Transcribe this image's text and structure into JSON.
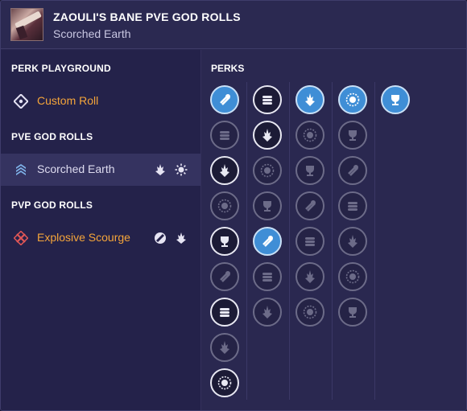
{
  "header": {
    "title": "ZAOULI'S BANE PVE GOD ROLLS",
    "subtitle": "Scorched Earth",
    "thumbnail_icon": "rocket-launcher-weapon-icon"
  },
  "sidebar": {
    "playground_header": "PERK PLAYGROUND",
    "custom_roll": {
      "label": "Custom Roll",
      "icon": "target-dot-icon"
    },
    "pve_header": "PVE GOD ROLLS",
    "pve_items": [
      {
        "label": "Scorched Earth",
        "icon": "chevron-rank-icon",
        "selected": true,
        "perk_icons": [
          "spire-perk-icon",
          "sunburst-perk-icon"
        ]
      }
    ],
    "pvp_header": "PVP GOD ROLLS",
    "pvp_items": [
      {
        "label": "Explosive Scourge",
        "icon": "crossed-x-icon",
        "selected": false,
        "perk_icons": [
          "slug-perk-icon",
          "spire-perk-icon"
        ]
      }
    ]
  },
  "perks": {
    "title": "PERKS",
    "accent": "#3f8ed6",
    "columns": [
      {
        "name": "barrel",
        "perks": [
          {
            "icon": "tube-launcher-icon",
            "state": "selected"
          },
          {
            "icon": "hatched-barrel-icon",
            "state": "dim"
          },
          {
            "icon": "smooth-bore-icon",
            "state": "available"
          },
          {
            "icon": "sight-bore-icon",
            "state": "dim"
          },
          {
            "icon": "crossed-bore-icon",
            "state": "available"
          },
          {
            "icon": "long-barrel-icon",
            "state": "dim"
          },
          {
            "icon": "ringed-barrel-icon",
            "state": "available"
          },
          {
            "icon": "coiled-barrel-icon",
            "state": "dim"
          },
          {
            "icon": "spiral-barrel-icon",
            "state": "available"
          }
        ]
      },
      {
        "name": "magazine",
        "perks": [
          {
            "icon": "stacked-rounds-icon",
            "state": "available"
          },
          {
            "icon": "card-magazine-icon",
            "state": "available"
          },
          {
            "icon": "tracker-round-icon",
            "state": "dim"
          },
          {
            "icon": "slim-mag-icon",
            "state": "dim"
          },
          {
            "icon": "folded-mag-icon",
            "state": "selected"
          },
          {
            "icon": "layered-mag-icon",
            "state": "dim"
          },
          {
            "icon": "crosshair-round-icon",
            "state": "dim"
          }
        ]
      },
      {
        "name": "trait-1",
        "perks": [
          {
            "icon": "spire-perk-icon",
            "state": "selected"
          },
          {
            "icon": "star-burst-icon",
            "state": "dim"
          },
          {
            "icon": "stacked-plates-icon",
            "state": "dim"
          },
          {
            "icon": "diamond-arrow-icon",
            "state": "dim"
          },
          {
            "icon": "figure-shield-icon",
            "state": "dim"
          },
          {
            "icon": "cross-ball-icon",
            "state": "dim"
          },
          {
            "icon": "ornate-ring-icon",
            "state": "dim"
          }
        ]
      },
      {
        "name": "trait-2",
        "perks": [
          {
            "icon": "sunburst-perk-icon",
            "state": "selected"
          },
          {
            "icon": "compass-rose-icon",
            "state": "dim"
          },
          {
            "icon": "flame-wreath-icon",
            "state": "dim"
          },
          {
            "icon": "flame-target-icon",
            "state": "dim"
          },
          {
            "icon": "skull-sun-icon",
            "state": "dim"
          },
          {
            "icon": "slash-oval-icon",
            "state": "dim"
          },
          {
            "icon": "broken-ring-icon",
            "state": "dim"
          }
        ]
      },
      {
        "name": "masterwork",
        "perks": [
          {
            "icon": "trophy-icon",
            "state": "selected"
          }
        ]
      }
    ]
  }
}
